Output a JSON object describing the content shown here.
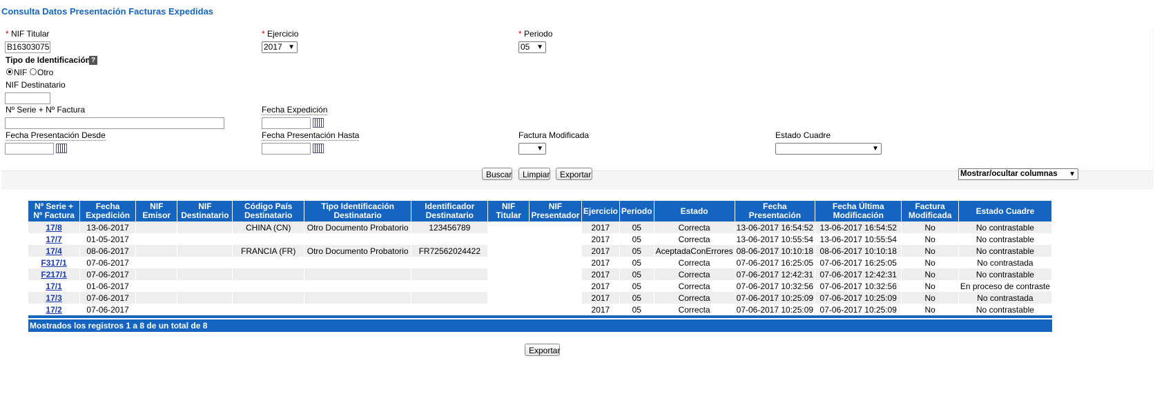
{
  "title": "Consulta Datos Presentación Facturas Expedidas",
  "form": {
    "nif_titular": {
      "label": "NIF Titular",
      "value": "B16303075"
    },
    "ejercicio": {
      "label": "Ejercicio",
      "value": "2017"
    },
    "periodo": {
      "label": "Periodo",
      "value": "05"
    },
    "tipo_identificacion": {
      "label": "Tipo de Identificación",
      "help": "?",
      "opt_nif": "NIF",
      "opt_otro": "Otro"
    },
    "nif_destinatario": {
      "label": "NIF Destinatario",
      "value": ""
    },
    "serie_factura": {
      "label": "Nº Serie + Nº Factura",
      "value": ""
    },
    "fecha_expedicion": {
      "label": "Fecha Expedición",
      "value": ""
    },
    "fecha_desde": {
      "label": "Fecha Presentación Desde",
      "value": ""
    },
    "fecha_hasta": {
      "label": "Fecha Presentación Hasta",
      "value": ""
    },
    "factura_modificada": {
      "label": "Factura Modificada",
      "value": ""
    },
    "estado_cuadre": {
      "label": "Estado Cuadre",
      "value": ""
    },
    "required_mark": "*"
  },
  "buttons": {
    "buscar": "Buscar",
    "limpiar": "Limpiar",
    "exportar": "Exportar",
    "columnas": "Mostrar/ocultar columnas"
  },
  "table": {
    "headers": [
      "Nº Serie + Nº Factura",
      "Fecha Expedición",
      "NIF Emisor",
      "NIF Destinatario",
      "Código País Destinatario",
      "Tipo Identificación Destinatario",
      "Identificador Destinatario",
      "NIF Titular",
      "NIF Presentador",
      "Ejercicio",
      "Periodo",
      "Estado",
      "Fecha Presentación",
      "Fecha Última Modificación",
      "Factura Modificada",
      "Estado Cuadre"
    ],
    "rows": [
      [
        "17/8",
        "13-06-2017",
        "",
        "",
        "CHINA (CN)",
        "Otro Documento Probatorio",
        "123456789",
        "",
        "",
        "2017",
        "05",
        "Correcta",
        "13-06-2017 16:54:52",
        "13-06-2017 16:54:52",
        "No",
        "No contrastable"
      ],
      [
        "17/7",
        "01-05-2017",
        "",
        "",
        "",
        "",
        "",
        "",
        "",
        "2017",
        "05",
        "Correcta",
        "13-06-2017 10:55:54",
        "13-06-2017 10:55:54",
        "No",
        "No contrastable"
      ],
      [
        "17/4",
        "08-06-2017",
        "",
        "",
        "FRANCIA (FR)",
        "Otro Documento Probatorio",
        "FR72562024422",
        "",
        "",
        "2017",
        "05",
        "AceptadaConErrores",
        "08-06-2017 10:10:18",
        "08-06-2017 10:10:18",
        "No",
        "No contrastable"
      ],
      [
        "F317/1",
        "07-06-2017",
        "",
        "",
        "",
        "",
        "",
        "",
        "",
        "2017",
        "05",
        "Correcta",
        "07-06-2017 16:25:05",
        "07-06-2017 16:25:05",
        "No",
        "No contrastada"
      ],
      [
        "F217/1",
        "07-06-2017",
        "",
        "",
        "",
        "",
        "",
        "",
        "",
        "2017",
        "05",
        "Correcta",
        "07-06-2017 12:42:31",
        "07-06-2017 12:42:31",
        "No",
        "No contrastable"
      ],
      [
        "17/1",
        "01-06-2017",
        "",
        "",
        "",
        "",
        "",
        "",
        "",
        "2017",
        "05",
        "Correcta",
        "07-06-2017 10:32:56",
        "07-06-2017 10:32:56",
        "No",
        "En proceso de contraste"
      ],
      [
        "17/3",
        "07-06-2017",
        "",
        "",
        "",
        "",
        "",
        "",
        "",
        "2017",
        "05",
        "Correcta",
        "07-06-2017 10:25:09",
        "07-06-2017 10:25:09",
        "No",
        "No contrastada"
      ],
      [
        "17/2",
        "07-06-2017",
        "",
        "",
        "",
        "",
        "",
        "",
        "",
        "2017",
        "05",
        "Correcta",
        "07-06-2017 10:25:09",
        "07-06-2017 10:25:09",
        "No",
        "No contrastable"
      ]
    ],
    "footer": "Mostrados los registros 1 a 8 de un total de 8"
  },
  "bottom_export": "Exportar"
}
